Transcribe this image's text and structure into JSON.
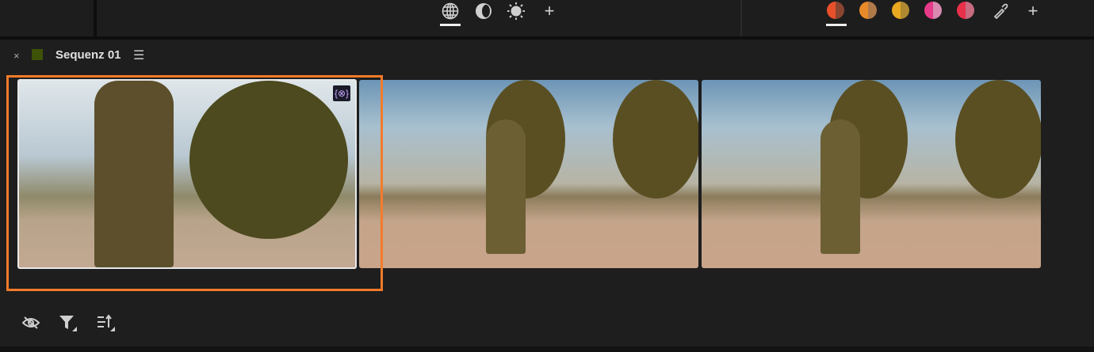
{
  "toolbar": {
    "view_tools": [
      {
        "icon": "globe-icon",
        "active": true
      },
      {
        "icon": "contrast-icon"
      },
      {
        "icon": "brightness-icon"
      },
      {
        "icon": "plus-icon"
      }
    ],
    "color_swatches": [
      {
        "left": "#e8502a",
        "right": "#8a4530",
        "active": true
      },
      {
        "left": "#e88a2a",
        "right": "#b07a48"
      },
      {
        "left": "#e8a820",
        "right": "#b08830"
      },
      {
        "left": "#e83a8a",
        "right": "#d88ab0"
      },
      {
        "left": "#e8304a",
        "right": "#c86a80"
      }
    ],
    "eyedropper_icon": "eyedropper-icon",
    "add_icon": "plus-icon"
  },
  "panel": {
    "close": "×",
    "sequence_color": "#3e5208",
    "title": "Sequenz 01",
    "menu": "☰"
  },
  "clips": [
    {
      "selected": true,
      "badge": "{⊗}"
    },
    {
      "selected": false
    },
    {
      "selected": false
    }
  ],
  "selection_color": "#f47b2a",
  "bottom_tools": [
    {
      "icon": "hide-icon"
    },
    {
      "icon": "filter-icon"
    },
    {
      "icon": "sort-icon"
    }
  ]
}
